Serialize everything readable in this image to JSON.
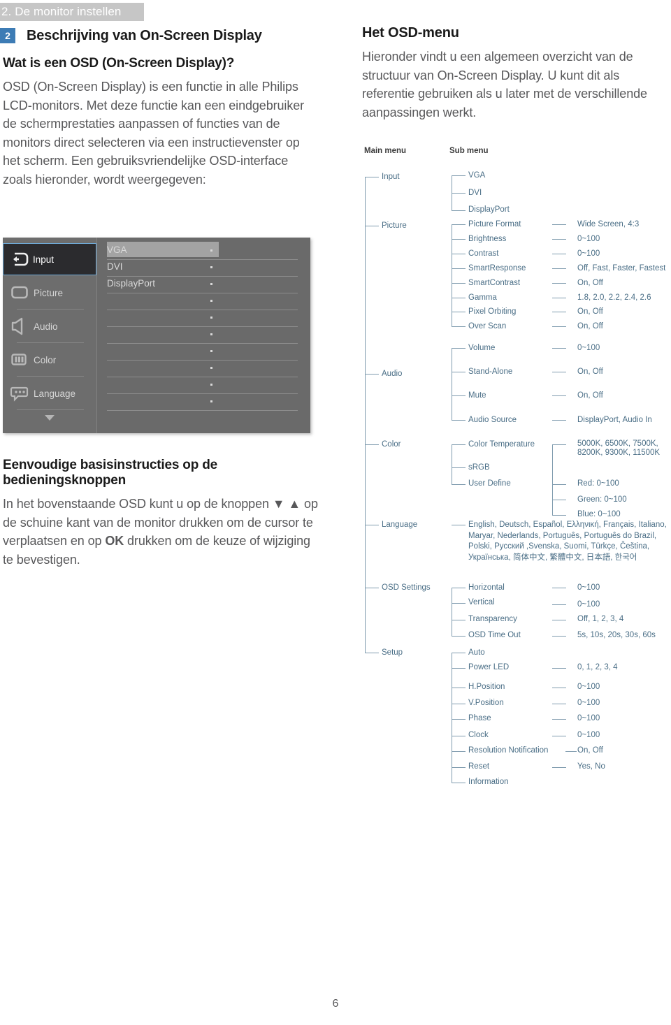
{
  "header": {
    "chapter_banner": "2. De monitor instellen",
    "section_number": "2",
    "section_title": "Beschrijving van On-Screen Display"
  },
  "left": {
    "question_heading": "Wat is een OSD (On-Screen Display)?",
    "paragraph": "OSD (On-Screen Display) is een functie in alle Philips LCD-monitors. Met deze functie kan een eindgebruiker de schermprestaties aanpassen of functies van de monitors direct selecteren via een instructievenster op het scherm. Een gebruiksvriendelijke OSD-interface zoals hieronder, wordt weergegeven:",
    "instructions_heading": "Eenvoudige basisinstructies op de bedieningsknoppen",
    "instructions_paragraph_1": "In het bovenstaande OSD kunt u op de knoppen ",
    "instructions_down_arrow": "▼",
    "instructions_up_arrow": "▲",
    "instructions_paragraph_2": " op de schuine kant van de monitor drukken om de cursor te verplaatsen en op ",
    "instructions_ok": "OK",
    "instructions_paragraph_3": " drukken om de keuze of wijziging te bevestigen."
  },
  "osd_screenshot": {
    "sidebar_items": [
      {
        "label": "Input",
        "icon": "input-icon",
        "selected": true
      },
      {
        "label": "Picture",
        "icon": "picture-icon",
        "selected": false
      },
      {
        "label": "Audio",
        "icon": "audio-icon",
        "selected": false
      },
      {
        "label": "Color",
        "icon": "color-icon",
        "selected": false
      },
      {
        "label": "Language",
        "icon": "language-icon",
        "selected": false
      }
    ],
    "scroll_indicator": "▼",
    "content_items": [
      {
        "label": "VGA",
        "highlighted": true
      },
      {
        "label": "DVI",
        "highlighted": false
      },
      {
        "label": "DisplayPort",
        "highlighted": false
      }
    ],
    "empty_row_count": 7,
    "colors": {
      "panel_bg": "#6a6a6a",
      "sidebar_bg": "#6d6d6d",
      "selected_bg": "#2b2b2e",
      "selected_border": "#6fa8d4",
      "highlight_bg": "#a3a3a3"
    }
  },
  "right": {
    "title": "Het OSD-menu",
    "paragraph": "Hieronder vindt u een algemeen overzicht van de structuur van On-Screen Display. U kunt dit als referentie gebruiken als u later met de verschillende aanpassingen werkt."
  },
  "tree": {
    "column_headers": {
      "main": "Main menu",
      "sub": "Sub menu"
    },
    "groups": [
      {
        "main": "Input",
        "items": [
          {
            "label": "VGA",
            "value": ""
          },
          {
            "label": "DVI",
            "value": ""
          },
          {
            "label": "DisplayPort",
            "value": ""
          }
        ]
      },
      {
        "main": "Picture",
        "items": [
          {
            "label": "Picture Format",
            "value": "Wide Screen, 4:3"
          },
          {
            "label": "Brightness",
            "value": "0~100"
          },
          {
            "label": "Contrast",
            "value": "0~100"
          },
          {
            "label": "SmartResponse",
            "value": "Off, Fast, Faster, Fastest"
          },
          {
            "label": "SmartContrast",
            "value": "On, Off"
          },
          {
            "label": "Gamma",
            "value": "1.8, 2.0, 2.2, 2.4, 2.6"
          },
          {
            "label": "Pixel Orbiting",
            "value": "On, Off"
          },
          {
            "label": "Over Scan",
            "value": "On, Off"
          }
        ]
      },
      {
        "main": "Audio",
        "items": [
          {
            "label": "Volume",
            "value": "0~100"
          },
          {
            "label": "Stand-Alone",
            "value": "On, Off"
          },
          {
            "label": "Mute",
            "value": "On, Off"
          },
          {
            "label": "Audio Source",
            "value": "DisplayPort, Audio In"
          }
        ]
      },
      {
        "main": "Color",
        "items": [
          {
            "label": "Color Temperature",
            "value": "5000K, 6500K, 7500K, 8200K, 9300K, 11500K"
          },
          {
            "label": "sRGB",
            "value": ""
          },
          {
            "label": "User Define",
            "value": "Red: 0~100"
          }
        ],
        "extra_values": [
          "Green: 0~100",
          "Blue: 0~100"
        ]
      },
      {
        "main": "Language",
        "items": [
          {
            "label": "English, Deutsch, Español, Ελληνική, Français, Italiano, Maryar, Nederlands, Português, Português do Brazil, Polski, Русский ,Svenska, Suomi, Türkçe, Čeština, Українська, 简体中文, 繁體中文, 日本語, 한국어",
            "value": ""
          }
        ]
      },
      {
        "main": "OSD Settings",
        "items": [
          {
            "label": "Horizontal",
            "value": "0~100"
          },
          {
            "label": "Vertical",
            "value": "0~100"
          },
          {
            "label": "Transparency",
            "value": "Off, 1, 2, 3, 4"
          },
          {
            "label": "OSD Time Out",
            "value": "5s, 10s, 20s, 30s, 60s"
          }
        ]
      },
      {
        "main": "Setup",
        "items": [
          {
            "label": "Auto",
            "value": ""
          },
          {
            "label": "Power LED",
            "value": "0, 1, 2, 3, 4"
          },
          {
            "label": "H.Position",
            "value": "0~100"
          },
          {
            "label": "V.Position",
            "value": "0~100"
          },
          {
            "label": "Phase",
            "value": "0~100"
          },
          {
            "label": "Clock",
            "value": "0~100"
          },
          {
            "label": "Resolution Notification",
            "value": "On, Off"
          },
          {
            "label": "Reset",
            "value": "Yes, No"
          },
          {
            "label": "Information",
            "value": ""
          }
        ]
      }
    ]
  },
  "footer": {
    "page_number": "6"
  },
  "colors": {
    "accent_blue": "#3d7cb5",
    "tree_text": "#4a6e86",
    "body_text": "#58585a",
    "banner_bg": "#c6c6c6"
  }
}
